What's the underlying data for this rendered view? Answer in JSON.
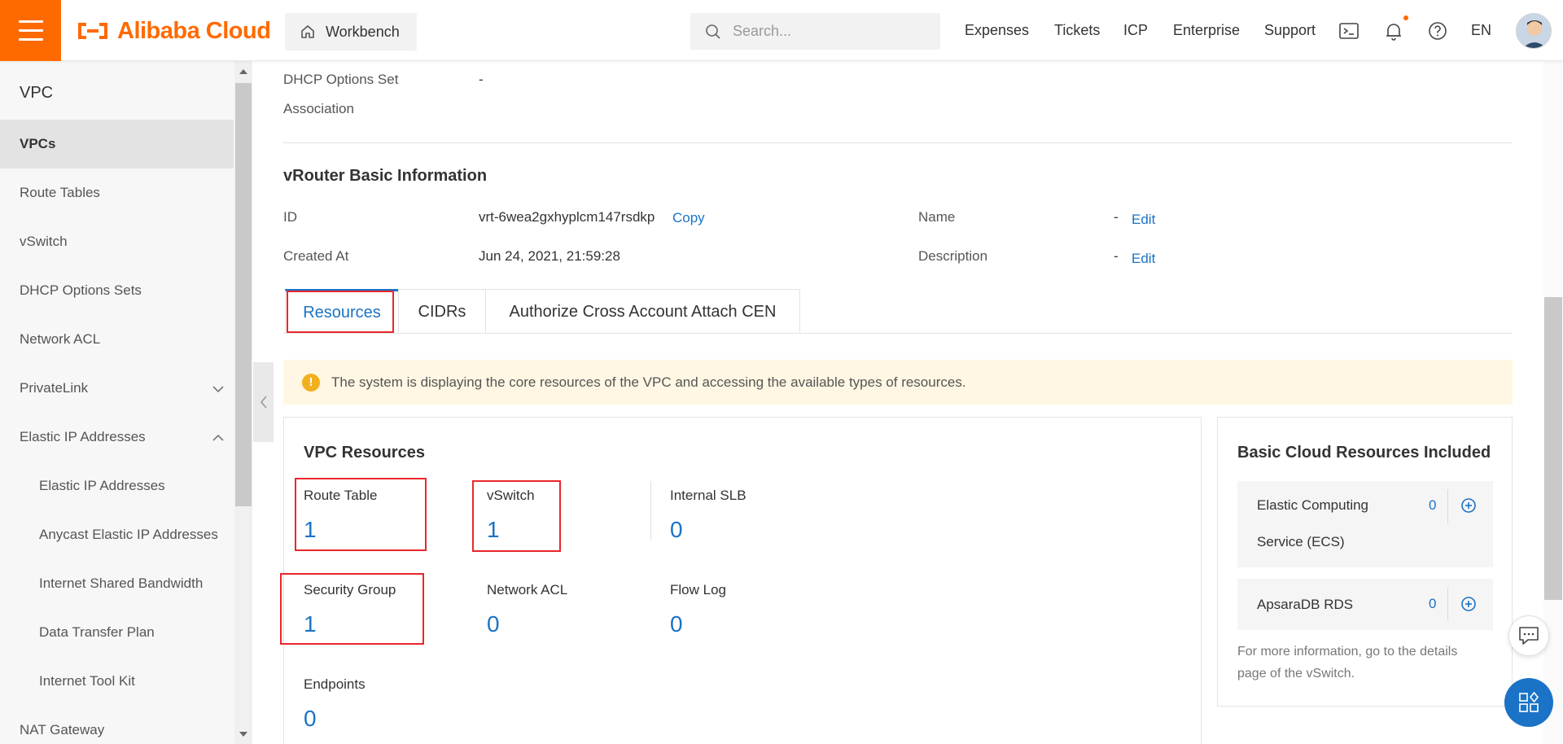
{
  "header": {
    "logo_text": "Alibaba Cloud",
    "workbench_label": "Workbench",
    "search_placeholder": "Search...",
    "nav": [
      "Expenses",
      "Tickets",
      "ICP",
      "Enterprise",
      "Support"
    ],
    "language": "EN",
    "brand_color": "#ff6a00"
  },
  "sidebar": {
    "title": "VPC",
    "items": [
      {
        "label": "VPCs",
        "active": true
      },
      {
        "label": "Route Tables"
      },
      {
        "label": "vSwitch"
      },
      {
        "label": "DHCP Options Sets"
      },
      {
        "label": "Network ACL"
      },
      {
        "label": "PrivateLink",
        "caret": "chevron-down-icon"
      },
      {
        "label": "Elastic IP Addresses",
        "caret": "chevron-up-icon"
      },
      {
        "label": "Elastic IP Addresses",
        "sub": true
      },
      {
        "label": "Anycast Elastic IP Addresses",
        "sub": true
      },
      {
        "label": "Internet Shared Bandwidth",
        "sub": true
      },
      {
        "label": "Data Transfer Plan",
        "sub": true
      },
      {
        "label": "Internet Tool Kit",
        "sub": true
      },
      {
        "label": "NAT Gateway"
      }
    ]
  },
  "dhcp": {
    "label_line1": "DHCP Options Set",
    "label_line2": "Association",
    "value": "-"
  },
  "vrouter": {
    "title": "vRouter Basic Information",
    "id_label": "ID",
    "id_value": "vrt-6wea2gxhyplcm147rsdkp",
    "copy_label": "Copy",
    "created_label": "Created At",
    "created_value": "Jun 24, 2021, 21:59:28",
    "name_label": "Name",
    "name_value": "-",
    "description_label": "Description",
    "description_value": "-",
    "edit_label": "Edit"
  },
  "tabs": [
    "Resources",
    "CIDRs",
    "Authorize Cross Account Attach CEN"
  ],
  "notice": "The system is displaying the core resources of the VPC and accessing the available types of resources.",
  "vpc_resources": {
    "title": "VPC Resources",
    "items": [
      {
        "label": "Route Table",
        "count": "1"
      },
      {
        "label": "vSwitch",
        "count": "1"
      },
      {
        "label": "Internal SLB",
        "count": "0"
      },
      {
        "label": "Security Group",
        "count": "1"
      },
      {
        "label": "Network ACL",
        "count": "0"
      },
      {
        "label": "Flow Log",
        "count": "0"
      },
      {
        "label": "Endpoints",
        "count": "0"
      }
    ]
  },
  "basic_resources": {
    "title": "Basic Cloud Resources Included",
    "items": [
      {
        "name_line1": "Elastic Computing",
        "name_line2": "Service (ECS)",
        "count": "0"
      },
      {
        "name_line1": "ApsaraDB RDS",
        "count": "0"
      }
    ],
    "footer_line1": "For more information, go to the details",
    "footer_line2": "page of the vSwitch."
  },
  "colors": {
    "link": "#1a73c6",
    "highlight_box": "#e8272c",
    "notice_bg": "#fff7e3",
    "active_nav_bg": "#e3e3e3"
  }
}
